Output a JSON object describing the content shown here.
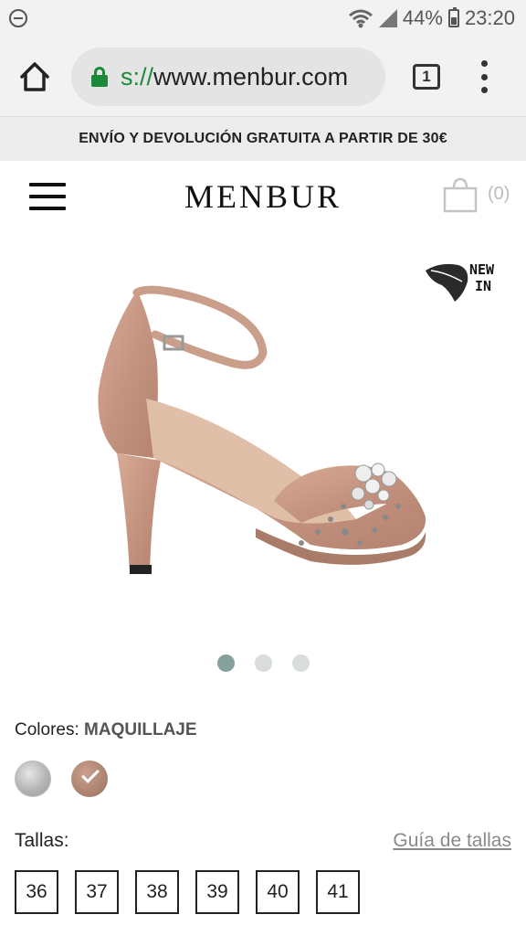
{
  "status_bar": {
    "battery": "44%",
    "time": "23:20",
    "icons": [
      "do-not-disturb-icon",
      "wifi-icon",
      "signal-icon",
      "battery-icon"
    ]
  },
  "browser": {
    "url_scheme": "s://",
    "url_rest": "www.menbur.com",
    "tab_count": "1",
    "icons": [
      "home-icon",
      "lock-icon",
      "tabs-icon",
      "overflow-menu-icon"
    ],
    "secure_color": "#1a8a3a"
  },
  "promo": {
    "text": "ENVÍO Y DEVOLUCIÓN GRATUITA A PARTIR DE 30€"
  },
  "header": {
    "logo": "MENBUR",
    "cart_count": "(0)"
  },
  "product": {
    "badge_line1": "NEW",
    "badge_line2": "IN",
    "gallery_dots": 3,
    "active_dot": 0
  },
  "colors": {
    "label": "Colores:",
    "selected": "MAQUILLAJE",
    "swatches": [
      {
        "name": "silver",
        "color": "#b4b4b4",
        "selected": false
      },
      {
        "name": "maquillaje",
        "color": "#ad8470",
        "selected": true
      }
    ]
  },
  "sizes": {
    "label": "Tallas:",
    "guide_link": "Guía de tallas",
    "options": [
      "36",
      "37",
      "38",
      "39",
      "40",
      "41"
    ]
  }
}
